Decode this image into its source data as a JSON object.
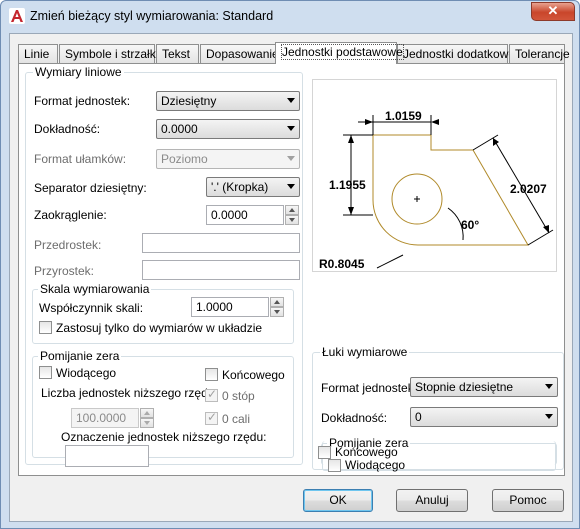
{
  "window": {
    "title": "Zmień bieżący styl wymiarowania: Standard",
    "close_symbol": "✕"
  },
  "tabs": [
    {
      "label": "Linie"
    },
    {
      "label": "Symbole i strzałki"
    },
    {
      "label": "Tekst"
    },
    {
      "label": "Dopasowanie"
    },
    {
      "label": "Jednostki podstawowe",
      "active": true
    },
    {
      "label": "Jednostki dodatkowe"
    },
    {
      "label": "Tolerancje"
    }
  ],
  "linear": {
    "legend": "Wymiary liniowe",
    "unit_format_label": "Format jednostek:",
    "unit_format_value": "Dziesiętny",
    "precision_label": "Dokładność:",
    "precision_value": "0.0000",
    "fraction_label": "Format ułamków:",
    "fraction_value": "Poziomo",
    "decimal_sep_label": "Separator dziesiętny:",
    "decimal_sep_value": "'.' (Kropka)",
    "roundoff_label": "Zaokrąglenie:",
    "roundoff_value": "0.0000",
    "prefix_label": "Przedrostek:",
    "prefix_value": "",
    "suffix_label": "Przyrostek:",
    "suffix_value": ""
  },
  "scale": {
    "legend": "Skala wymiarowania",
    "factor_label": "Współczynnik skali:",
    "factor_value": "1.0000",
    "layout_only_label": "Zastosuj tylko do wymiarów w układzie"
  },
  "zero_linear": {
    "legend": "Pomijanie zera",
    "leading_label": "Wiodącego",
    "trailing_label": "Końcowego",
    "sub_units_factor_label": "Liczba jednostek niższego rzędu:",
    "sub_units_factor_value": "100.0000",
    "feet_label": "0 stóp",
    "inches_label": "0 cali",
    "sub_unit_suffix_label": "Oznaczenie jednostek niższego rzędu:",
    "sub_unit_suffix_value": ""
  },
  "preview": {
    "dim_top": "1.0159",
    "dim_left": "1.1955",
    "dim_right": "2.0207",
    "dim_angle": "60°",
    "dim_radius": "R0.8045",
    "line_color": "#b08a2a"
  },
  "angular": {
    "legend": "Łuki wymiarowe",
    "unit_format_label": "Format jednostek:",
    "unit_format_value": "Stopnie dziesiętne",
    "precision_label": "Dokładność:",
    "precision_value": "0"
  },
  "zero_angular": {
    "legend": "Pomijanie zera",
    "leading_label": "Wiodącego",
    "trailing_label": "Końcowego"
  },
  "buttons": {
    "ok": "OK",
    "cancel": "Anuluj",
    "help": "Pomoc"
  }
}
